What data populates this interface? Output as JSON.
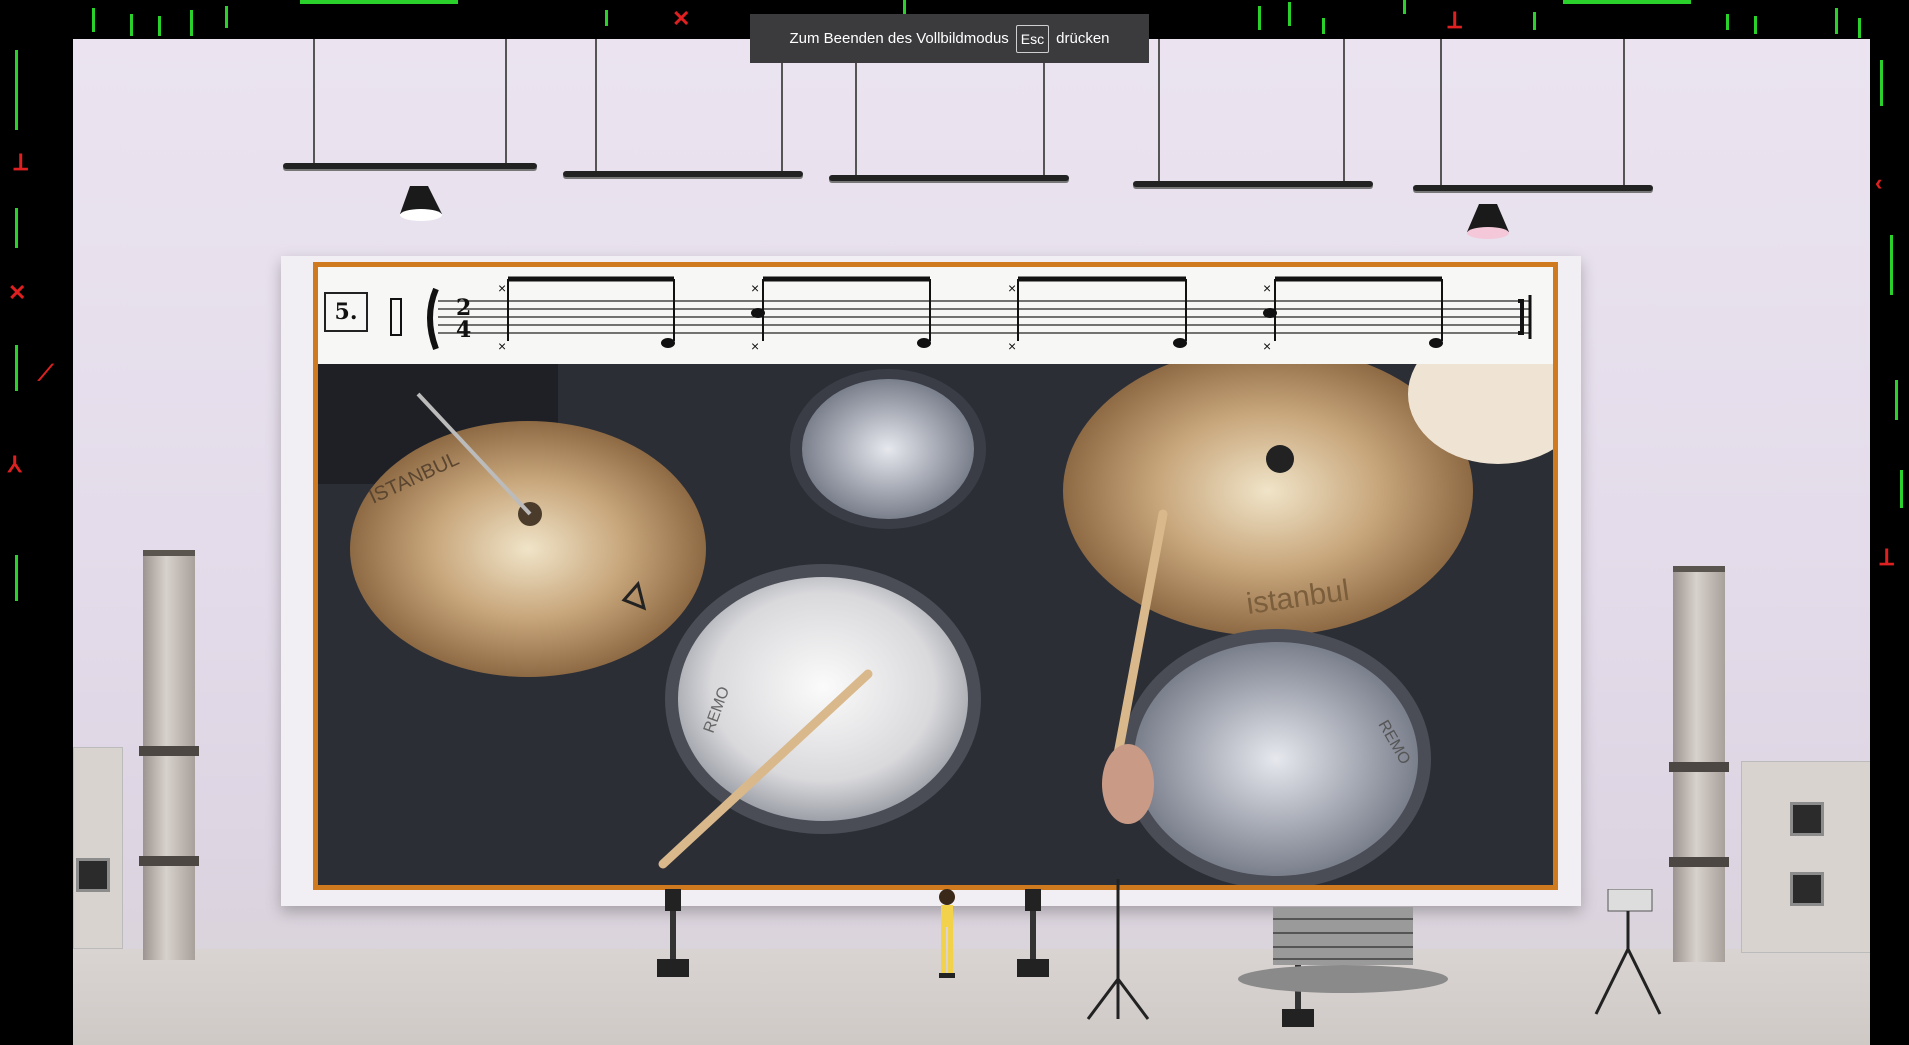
{
  "fullscreen_notice": {
    "before": "Zum Beenden des Vollbildmodus",
    "key": "Esc",
    "after": "drücken"
  },
  "score": {
    "measure_number": "5.",
    "time_signature_top": "2",
    "time_signature_bottom": "4"
  },
  "cymbal_brand_left": "ISTANBUL",
  "cymbal_brand_right": "istanbul",
  "drumhead_brand": "REMO",
  "colors": {
    "frame_accent": "#d07a20",
    "notice_bg": "#3b3b3e",
    "overlay_green": "#2ad12a",
    "overlay_red": "#e02020"
  }
}
